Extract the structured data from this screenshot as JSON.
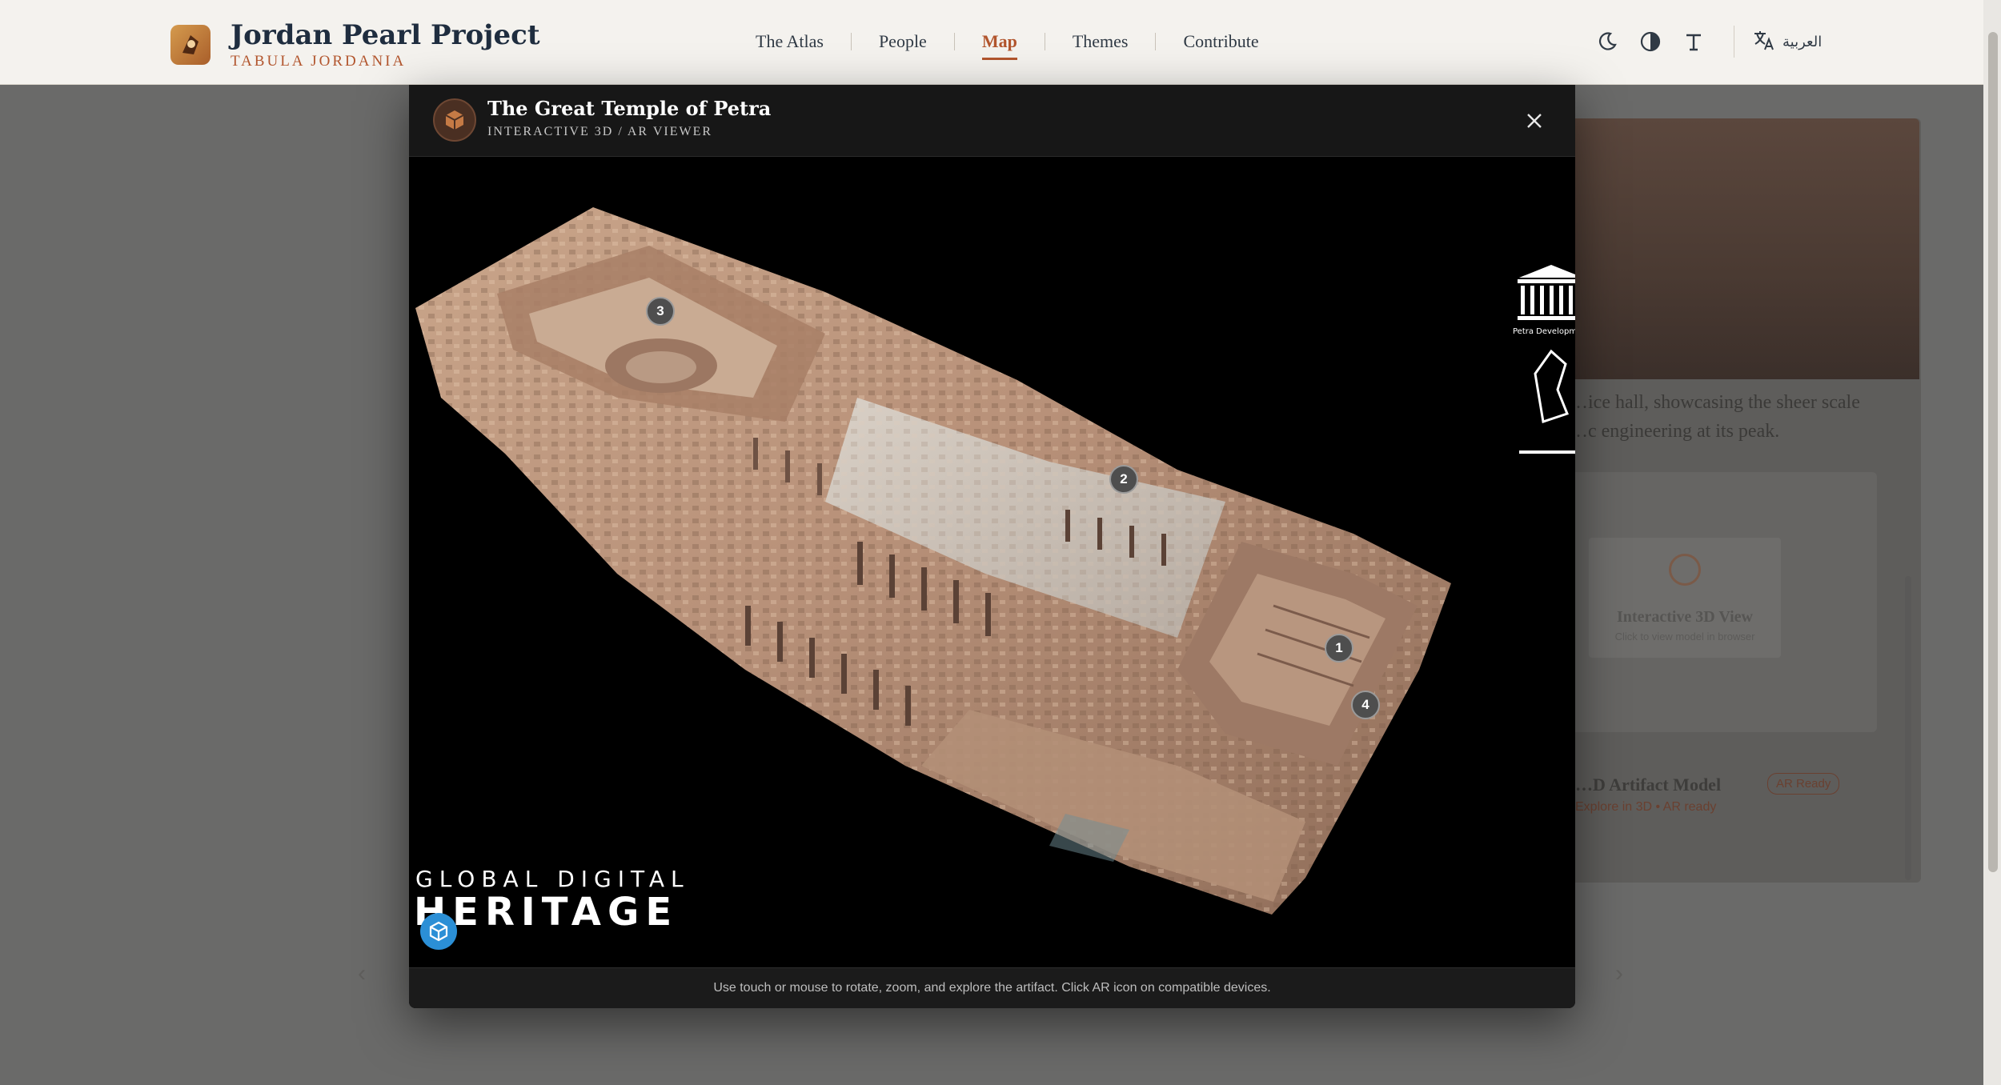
{
  "brand": {
    "title": "Jordan Pearl Project",
    "subtitle": "TABULA JORDANIA"
  },
  "nav": {
    "items": [
      "The Atlas",
      "People",
      "Map",
      "Themes",
      "Contribute"
    ],
    "active": "Map"
  },
  "tools": {
    "icons": [
      "theme-moon-icon",
      "contrast-icon",
      "text-size-icon",
      "translate-icon"
    ],
    "language_label": "العربية"
  },
  "background_page": {
    "text_line1": "…ice hall, showcasing the sheer scale",
    "text_line2": "…c engineering at its peak.",
    "tile_title": "Interactive 3D View",
    "tile_sub": "Click to view model in browser",
    "artifact_title": "…D Artifact Model",
    "artifact_sub": "Explore in 3D • AR ready",
    "artifact_badge": "AR Ready"
  },
  "modal": {
    "title": "The Great Temple of Petra",
    "subtitle": "INTERACTIVE 3D / AR VIEWER",
    "footer_note": "Use touch or mouse to rotate, zoom, and explore the artifact. Click AR icon on compatible devices.",
    "hotspots": [
      "1",
      "2",
      "3",
      "4"
    ],
    "watermark_top": "GLOBAL DIGITAL",
    "watermark_bottom": "HERITAGE",
    "partner_logo_text": "Petra Development"
  },
  "colors": {
    "accent": "#b2552d",
    "navy": "#1f2d3f",
    "ar_blue": "#2b8fd6"
  }
}
